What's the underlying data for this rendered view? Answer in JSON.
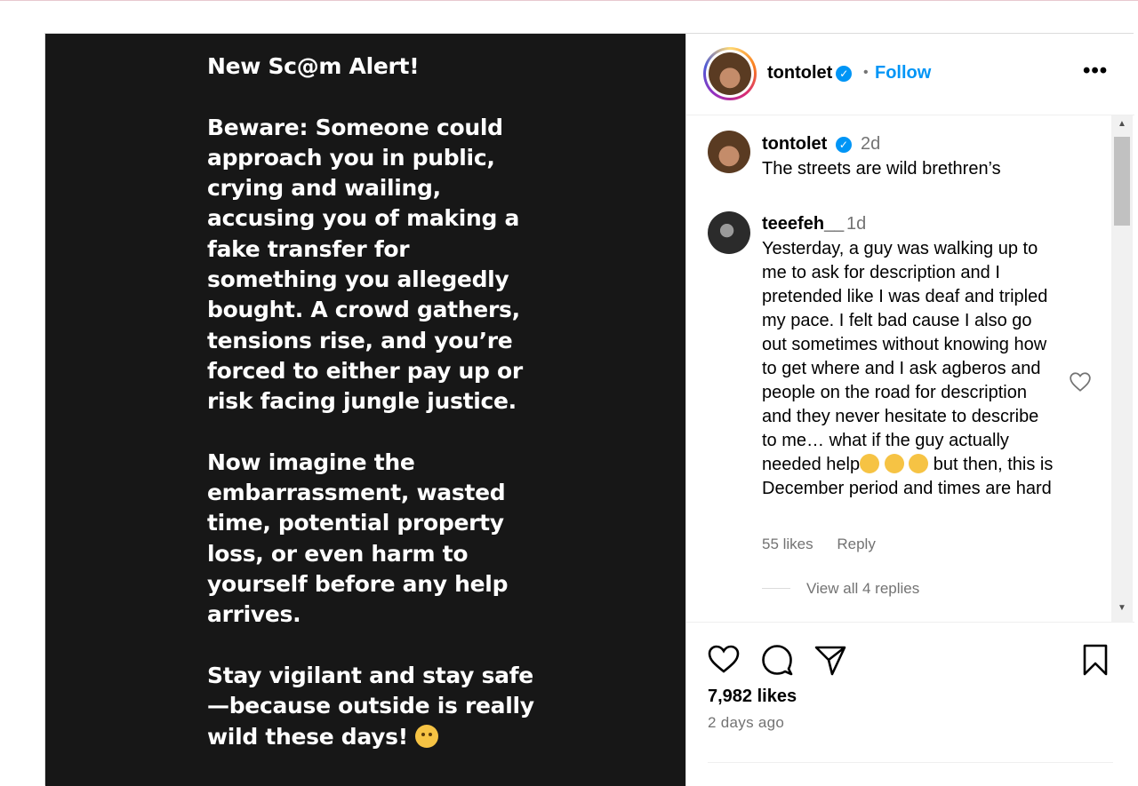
{
  "post_media": {
    "heading": "New Sc@m Alert!",
    "paragraphs": [
      "Beware: Someone could approach you in public, crying and wailing, accusing you of making a fake transfer for something you allegedly bought. A crowd gathers, tensions rise, and you’re forced to either pay up or risk facing jungle justice.",
      "Now imagine the embarrassment, wasted time, potential property loss, or even harm to yourself before any help arrives."
    ],
    "closing": "Stay vigilant and stay safe—because outside is really wild these days!"
  },
  "header": {
    "username": "tontolet",
    "separator": "•",
    "follow_label": "Follow",
    "more_label": "•••"
  },
  "comments": [
    {
      "username": "tontolet",
      "time": "2d",
      "text": "The streets are wild brethren’s"
    },
    {
      "username": "teeefeh__",
      "time": "1d",
      "text_part1": "Yesterday, a guy was walking up to me to ask for description and I pretended like I was deaf and tripled my pace. I felt bad cause I also go out sometimes without knowing how to get where and I ask agberos and people on the road for description and they never hesitate to describe to me… what if the guy actually needed help",
      "text_part2": " but then, this is December period and times are hard",
      "likes": "55 likes",
      "reply_label": "Reply",
      "view_replies": "View all 4 replies"
    }
  ],
  "footer": {
    "likes": "7,982 likes",
    "posted": "2 days ago"
  },
  "colors": {
    "accent": "#0095f6",
    "media_bg": "#171717",
    "muted": "#737373"
  }
}
